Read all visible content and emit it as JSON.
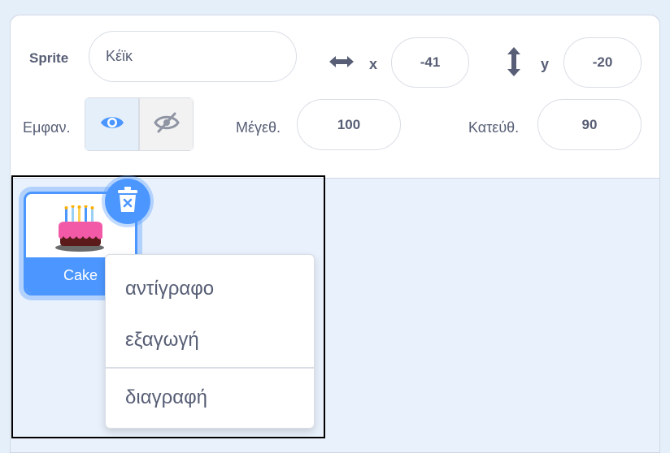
{
  "sprite_info": {
    "sprite_label": "Sprite",
    "sprite_name": "Κέϊκ",
    "x_label": "x",
    "x_value": "-41",
    "y_label": "y",
    "y_value": "-20",
    "show_label": "Εμφαν.",
    "visible": true,
    "size_label": "Μέγεθ.",
    "size_value": "100",
    "direction_label": "Κατεύθ.",
    "direction_value": "90"
  },
  "sprite_list": [
    {
      "name": "Cake",
      "selected": true,
      "icon": "cake-costume"
    }
  ],
  "context_menu": {
    "items": [
      {
        "label": "αντίγραφο"
      },
      {
        "label": "εξαγωγή"
      },
      {
        "label": "διαγραφή"
      }
    ]
  },
  "icons": {
    "x_axis": "horizontal-arrows-icon",
    "y_axis": "vertical-arrows-icon",
    "show": "eye-icon",
    "hide": "eye-slash-icon",
    "delete": "trash-icon"
  },
  "colors": {
    "accent": "#4c97ff",
    "text": "#575e75",
    "pane": "#e9f1fc"
  }
}
